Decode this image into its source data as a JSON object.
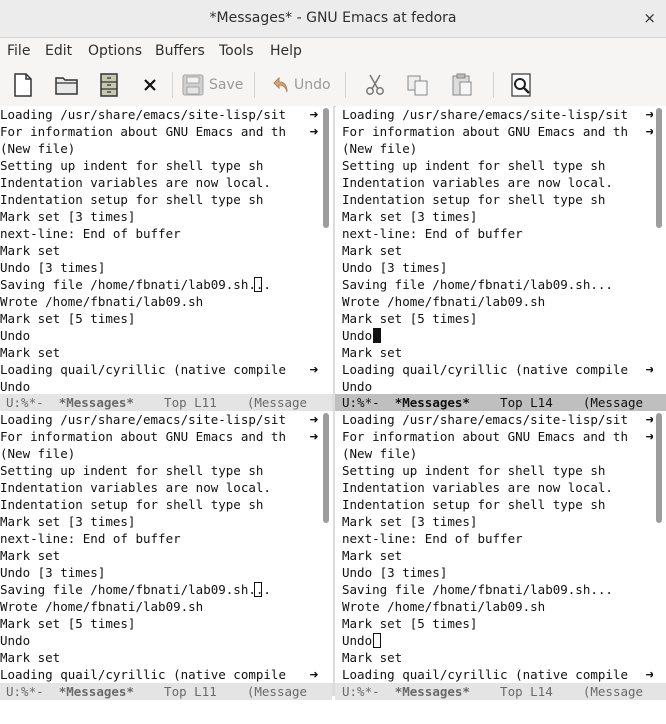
{
  "window": {
    "title": "*Messages* - GNU Emacs at fedora",
    "close_glyph": "×"
  },
  "menu": [
    "File",
    "Edit",
    "Options",
    "Buffers",
    "Tools",
    "Help"
  ],
  "toolbar": {
    "save_label": "Save",
    "undo_label": "Undo"
  },
  "lines": [
    "Loading /usr/share/emacs/site-lisp/sit",
    "For information about GNU Emacs and th",
    "(New file)",
    "Setting up indent for shell type sh",
    "Indentation variables are now local.",
    "Indentation setup for shell type sh",
    "Mark set [3 times]",
    "next-line: End of buffer",
    "Mark set",
    "Undo [3 times]",
    "Saving file /home/fbnati/lab09.sh...",
    "Wrote /home/fbnati/lab09.sh",
    "Mark set [5 times]",
    "Undo",
    "Mark set",
    "Loading quail/cyrillic (native compile",
    "Undo"
  ],
  "bottom_last_line": "Loading quail/cyrillic (native compile",
  "modelines": {
    "left": {
      "state": "U:%*-  ",
      "buffer": "*Messages*",
      "position": "    Top L11    (Message"
    },
    "right": {
      "state": "U:%*-  ",
      "buffer": "*Messages*",
      "position": "    Top L14    (Message"
    }
  },
  "colors": {
    "active_modeline": "#bfbfbf",
    "inactive_modeline": "#e4e4e4"
  }
}
